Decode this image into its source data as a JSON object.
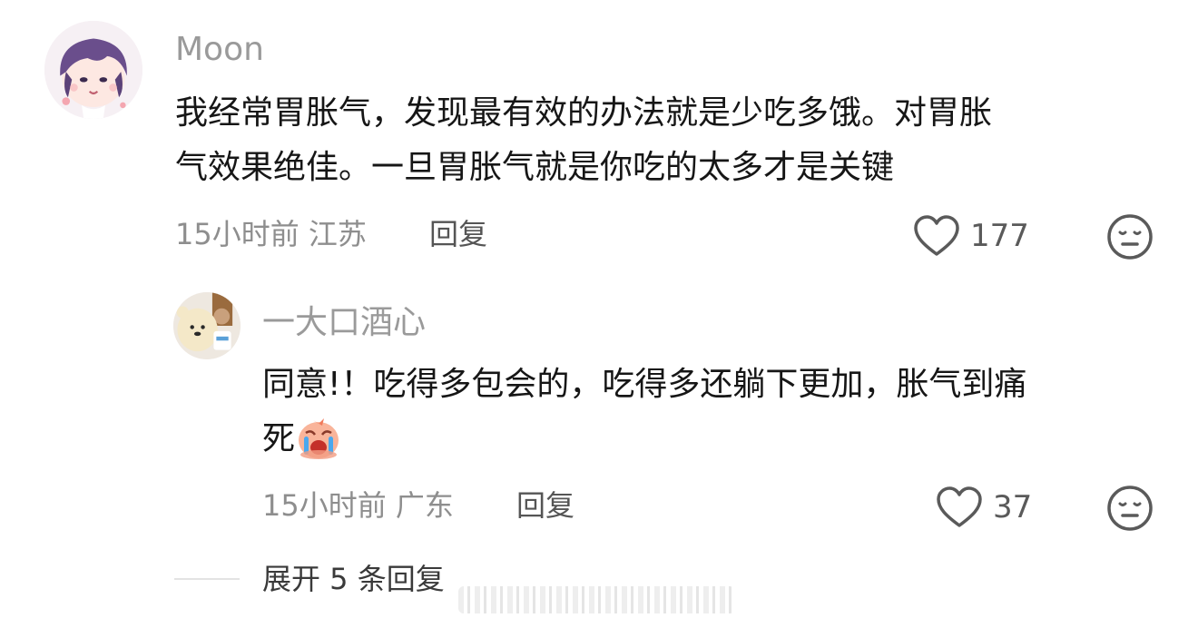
{
  "comments": [
    {
      "username": "Moon",
      "text_line1": "我经常胃胀气，发现最有效的办法就是少吃多饿。对胃胀",
      "text_line2": "气效果绝佳。一旦胃胀气就是你吃的太多才是关键",
      "time": "15小时前",
      "location": "江苏",
      "reply_label": "回复",
      "likes": "177",
      "avatar_icon": "anime-avatar-purple-hair",
      "like_icon": "heart-outline-icon",
      "dislike_icon": "neutral-face-icon"
    },
    {
      "username": "一大口酒心",
      "text_line1": "同意!！吃得多包会的，吃得多还躺下更加，胀气到痛",
      "text_line2": "死",
      "time": "15小时前",
      "location": "广东",
      "reply_label": "回复",
      "likes": "37",
      "avatar_icon": "bear-doll-avatar",
      "emoji_icon": "crying-emoji",
      "like_icon": "heart-outline-icon",
      "dislike_icon": "neutral-face-icon"
    }
  ],
  "expand": {
    "label": "展开 5 条回复"
  },
  "colors": {
    "username": "#9a9a9a",
    "text": "#161616",
    "meta": "#8e8e8e"
  }
}
